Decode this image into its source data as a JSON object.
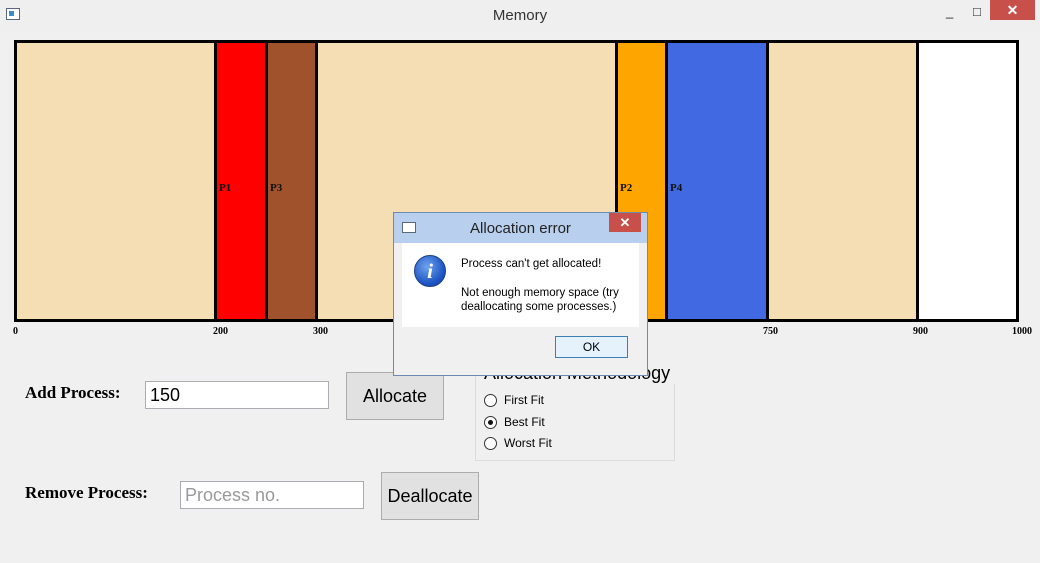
{
  "window": {
    "title": "Memory",
    "controls": {
      "minimize": "_",
      "maximize": "□",
      "close": "✕"
    }
  },
  "memory": {
    "total": 1000,
    "segments": [
      {
        "start": 0,
        "end": 200,
        "label": "",
        "color": "#f5deb3"
      },
      {
        "start": 200,
        "end": 250,
        "label": "P1",
        "color": "#ff0000"
      },
      {
        "start": 250,
        "end": 300,
        "label": "P3",
        "color": "#a0522d"
      },
      {
        "start": 300,
        "end": 600,
        "label": "",
        "color": "#f5deb3"
      },
      {
        "start": 600,
        "end": 650,
        "label": "P2",
        "color": "#ffa500"
      },
      {
        "start": 650,
        "end": 750,
        "label": "P4",
        "color": "#4169e1"
      },
      {
        "start": 750,
        "end": 900,
        "label": "",
        "color": "#f5deb3"
      },
      {
        "start": 900,
        "end": 1000,
        "label": "",
        "color": "#ffffff"
      }
    ],
    "ticks": [
      "0",
      "200",
      "300",
      "750",
      "900",
      "1000"
    ]
  },
  "controls": {
    "add_label": "Add Process:",
    "add_value": "150",
    "allocate_label": "Allocate",
    "remove_label": "Remove Process:",
    "remove_placeholder": "Process no.",
    "deallocate_label": "Deallocate"
  },
  "method": {
    "title": "Allocation Methodology",
    "options": [
      {
        "label": "First Fit",
        "selected": false
      },
      {
        "label": "Best Fit",
        "selected": true
      },
      {
        "label": "Worst Fit",
        "selected": false
      }
    ]
  },
  "dialog": {
    "title": "Allocation error",
    "icon": "info-icon",
    "message1": "Process can't get allocated!",
    "message2": "Not enough memory space (try",
    "message3": "deallocating some processes.)",
    "ok_label": "OK"
  }
}
